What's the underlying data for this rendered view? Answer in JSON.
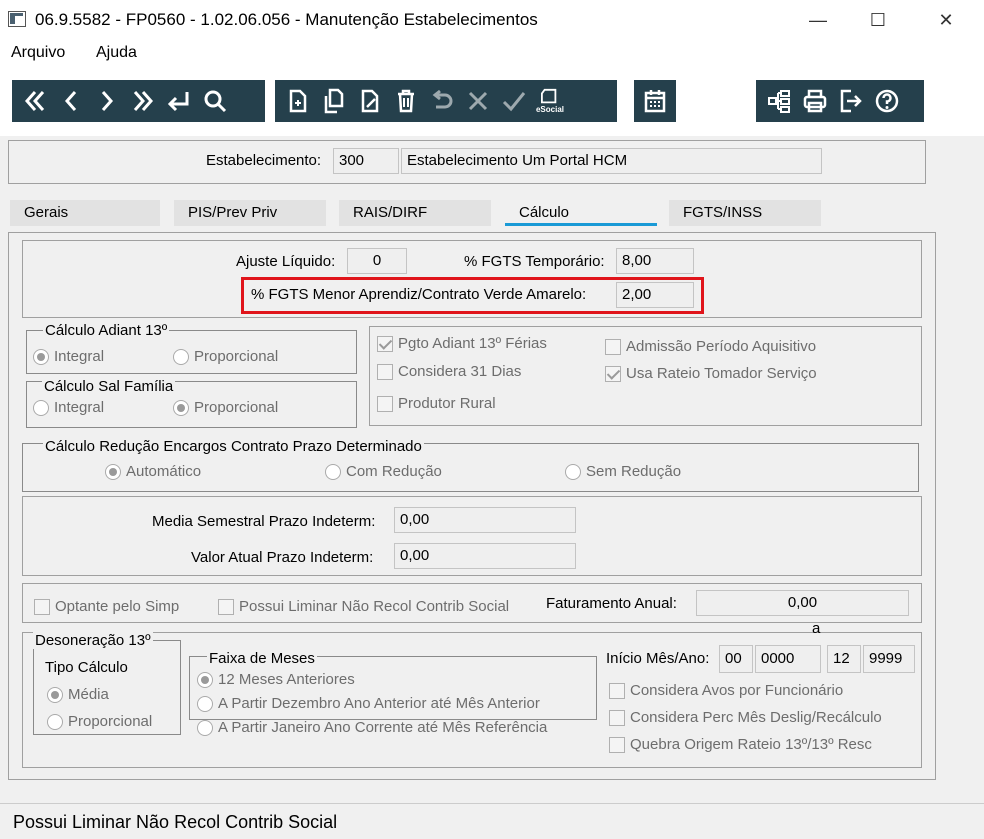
{
  "window": {
    "title": "06.9.5582 - FP0560 - 1.02.06.056 - Manutenção Estabelecimentos",
    "minimize": "—",
    "maximize": "☐",
    "close": "✕"
  },
  "menu": {
    "file": "Arquivo",
    "help": "Ajuda"
  },
  "toolbar": {
    "nav": [
      "first-icon",
      "previous-icon",
      "next-icon",
      "last-icon",
      "return-icon",
      "search-icon"
    ],
    "edit": [
      "new-icon",
      "copy-icon",
      "edit-icon",
      "delete-icon",
      "undo-icon",
      "cancel-icon",
      "confirm-icon",
      "esocial-icon"
    ],
    "esocial_label": "eSocial",
    "other": [
      "calendar-icon"
    ],
    "right": [
      "structure-icon",
      "print-icon",
      "exit-icon",
      "help-icon"
    ],
    "icon_color": "#ffffff",
    "bg_color": "#25404c"
  },
  "header": {
    "estab_label": "Estabelecimento:",
    "estab_code": "300",
    "estab_name": "Estabelecimento Um Portal HCM"
  },
  "tabs": [
    {
      "label": "Gerais"
    },
    {
      "label": "PIS/Prev Priv"
    },
    {
      "label": "RAIS/DIRF"
    },
    {
      "label": "Cálculo"
    },
    {
      "label": "FGTS/INSS"
    }
  ],
  "calc": {
    "ajuste_label": "Ajuste Líquido:",
    "ajuste_value": "0",
    "fgts_temp_label": "% FGTS Temporário:",
    "fgts_temp_value": "8,00",
    "fgts_aprendiz_label": "% FGTS Menor Aprendiz/Contrato Verde Amarelo:",
    "fgts_aprendiz_value": "2,00",
    "highlight_color": "#e0151b"
  },
  "adiant13": {
    "title": "Cálculo Adiant 13º",
    "integral": "Integral",
    "proporcional": "Proporcional"
  },
  "salfamilia": {
    "title": "Cálculo Sal Família",
    "integral": "Integral",
    "proporcional": "Proporcional"
  },
  "checks1": {
    "pgto_adiant": "Pgto Adiant 13º Férias",
    "considera31": "Considera 31 Dias",
    "produtor": "Produtor Rural",
    "admissao": "Admissão Período Aquisitivo",
    "rateio": "Usa Rateio Tomador Serviço"
  },
  "reducao": {
    "title": "Cálculo Redução Encargos Contrato Prazo Determinado",
    "auto": "Automático",
    "com": "Com Redução",
    "sem": "Sem Redução"
  },
  "prazo": {
    "media_label": "Media Semestral Prazo Indeterm:",
    "media_value": "0,00",
    "valor_label": "Valor Atual Prazo Indeterm:",
    "valor_value": "0,00"
  },
  "simp": {
    "optante": "Optante pelo Simp",
    "liminar": "Possui Liminar Não Recol Contrib Social",
    "fat_label": "Faturamento Anual:",
    "fat_value": "0,00"
  },
  "desoneracao": {
    "title": "Desoneração 13º",
    "tipo_label": "Tipo Cálculo",
    "media": "Média",
    "proporcional": "Proporcional",
    "faixa_label": "Faixa de Meses",
    "faixa1": "12 Meses Anteriores",
    "faixa2": "A Partir Dezembro Ano Anterior até Mês Anterior",
    "faixa3": "A Partir Janeiro Ano Corrente até Mês Referência",
    "inicio_label": "Início Mês/Ano:",
    "inicio_mes": "00",
    "inicio_ano": "0000",
    "a_label": "a",
    "fim_mes": "12",
    "fim_ano": "9999",
    "avos": "Considera Avos por Funcionário",
    "perc": "Considera Perc Mês Deslig/Recálculo",
    "quebra": "Quebra Origem Rateio 13º/13º Resc"
  },
  "status": {
    "text": "Possui Liminar Não Recol Contrib Social"
  }
}
